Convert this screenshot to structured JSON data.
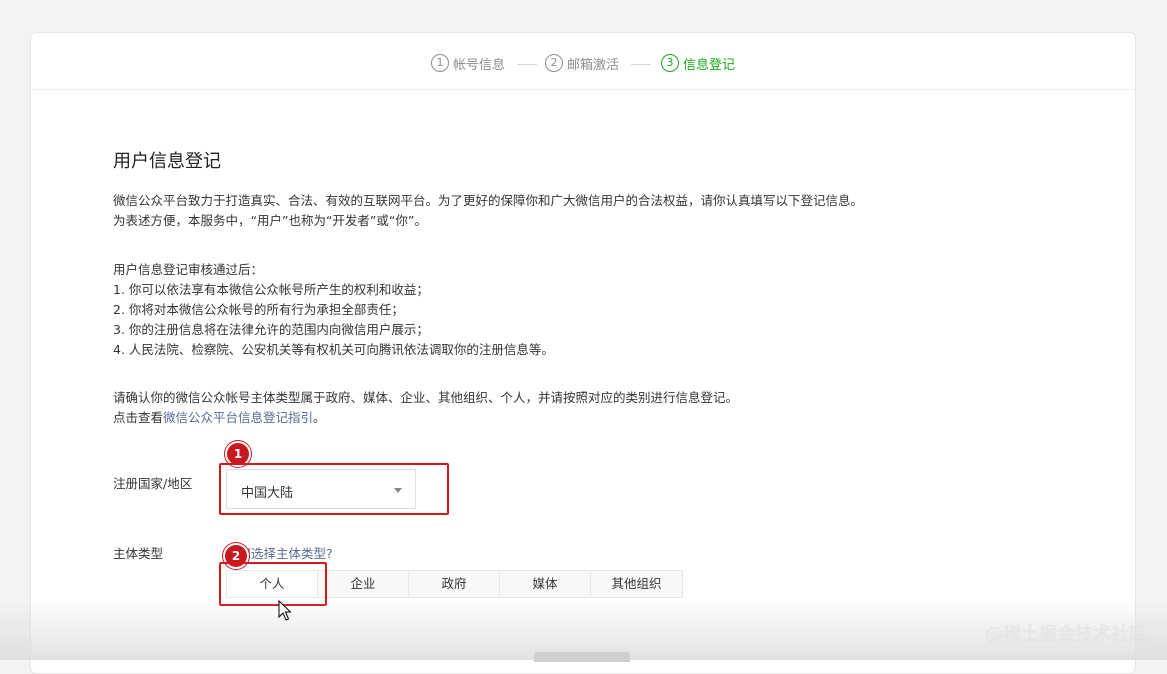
{
  "steps": [
    {
      "num": "1",
      "label": "帐号信息",
      "active": false
    },
    {
      "num": "2",
      "label": "邮箱激活",
      "active": false
    },
    {
      "num": "3",
      "label": "信息登记",
      "active": true
    }
  ],
  "page_title": "用户信息登记",
  "intro": {
    "line1": "微信公众平台致力于打造真实、合法、有效的互联网平台。为了更好的保障你和广大微信用户的合法权益，请你认真填写以下登记信息。",
    "line2": "为表述方便，本服务中，“用户”也称为“开发者”或“你”。"
  },
  "review": {
    "heading": "用户信息登记审核通过后：",
    "items": [
      "1. 你可以依法享有本微信公众帐号所产生的权利和收益；",
      "2. 你将对本微信公众帐号的所有行为承担全部责任；",
      "3. 你的注册信息将在法律允许的范围内向微信用户展示；",
      "4. 人民法院、检察院、公安机关等有权机关可向腾讯依法调取你的注册信息等。"
    ]
  },
  "confirm": {
    "line1": "请确认你的微信公众帐号主体类型属于政府、媒体、企业、其他组织、个人，并请按照对应的类别进行信息登记。",
    "prefix": "点击查看",
    "link": "微信公众平台信息登记指引",
    "suffix": "。"
  },
  "region": {
    "label": "注册国家/地区",
    "value": "中国大陆",
    "badge": "1"
  },
  "subject": {
    "label": "主体类型",
    "help_link": "如何选择主体类型?",
    "badge": "2",
    "options": [
      "个人",
      "企业",
      "政府",
      "媒体",
      "其他组织"
    ],
    "selected": "个人"
  },
  "watermark": "@稀土掘金技术社区",
  "colors": {
    "accent_green": "#1aad19",
    "link": "#576b95",
    "annotation_red": "#d21a1a"
  }
}
